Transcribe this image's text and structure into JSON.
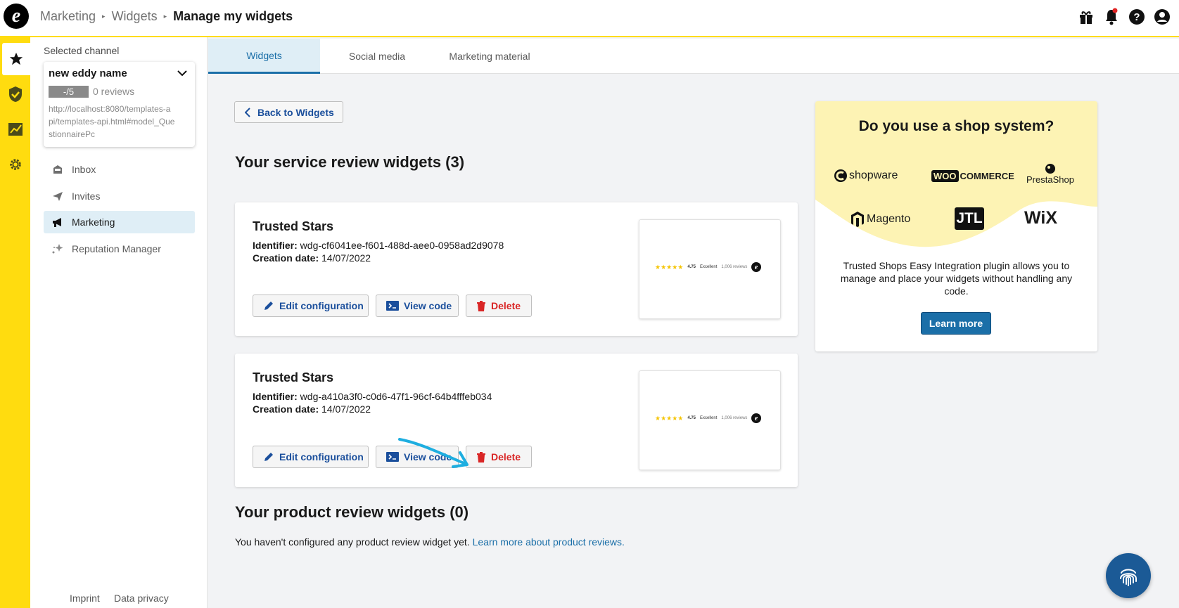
{
  "header": {
    "breadcrumbs": [
      "Marketing",
      "Widgets"
    ],
    "current": "Manage my widgets",
    "icons": [
      "gift-icon",
      "bell-icon",
      "help-icon",
      "account-icon"
    ]
  },
  "rail": {
    "items": [
      "star-icon",
      "shield-check-icon",
      "chart-icon",
      "gear-icon"
    ],
    "expand_icon": "chevron-right-icon"
  },
  "sidebar": {
    "selected_label": "Selected channel",
    "channel": {
      "name": "new eddy name",
      "score": "-/5",
      "reviews": "0 reviews",
      "url": "http://localhost:8080/templates-api/templates-api.html#model_QuestionnairePc"
    },
    "nav": [
      {
        "label": "Inbox",
        "icon": "inbox-icon"
      },
      {
        "label": "Invites",
        "icon": "send-icon"
      },
      {
        "label": "Marketing",
        "icon": "megaphone-icon"
      },
      {
        "label": "Reputation Manager",
        "icon": "sparkle-icon"
      }
    ],
    "footer": {
      "imprint": "Imprint",
      "privacy": "Data privacy"
    }
  },
  "tabs": [
    {
      "label": "Widgets",
      "active": true
    },
    {
      "label": "Social media",
      "active": false
    },
    {
      "label": "Marketing material",
      "active": false
    }
  ],
  "main": {
    "back_label": "Back to Widgets",
    "service_heading": "Your service review widgets (3)",
    "identifier_label": "Identifier:",
    "date_label": "Creation date:",
    "edit_label": "Edit configuration",
    "view_label": "View code",
    "delete_label": "Delete",
    "widgets": [
      {
        "title": "Trusted Stars",
        "identifier": "wdg-cf6041ee-f601-488d-aee0-0958ad2d9078",
        "date": "14/07/2022",
        "preview": {
          "stars": "★★★★★",
          "rating": "4.75",
          "grade": "Excellent",
          "count": "1,006 reviews"
        }
      },
      {
        "title": "Trusted Stars",
        "identifier": "wdg-a410a3f0-c0d6-47f1-96cf-64b4fffeb034",
        "date": "14/07/2022",
        "preview": {
          "stars": "★★★★★",
          "rating": "4.75",
          "grade": "Excellent",
          "count": "1,006 reviews"
        }
      }
    ],
    "product_heading": "Your product review widgets (0)",
    "product_text": "You haven't configured any product review widget yet.",
    "product_link": "Learn more about product reviews."
  },
  "promo": {
    "title": "Do you use a shop system?",
    "logos": [
      "shopware",
      "WOO",
      "COMMERCE",
      "PrestaShop",
      "Magento",
      "JTL",
      "WiX"
    ],
    "text": "Trusted Shops Easy Integration plugin allows you to manage and place your widgets without handling any code.",
    "button": "Learn more"
  },
  "colors": {
    "brand_yellow": "#ffdc0f",
    "link_blue": "#1b6fa8",
    "button_blue": "#1b4f9c",
    "delete_red": "#d92626",
    "annotation_arrow": "#1eaee0"
  }
}
